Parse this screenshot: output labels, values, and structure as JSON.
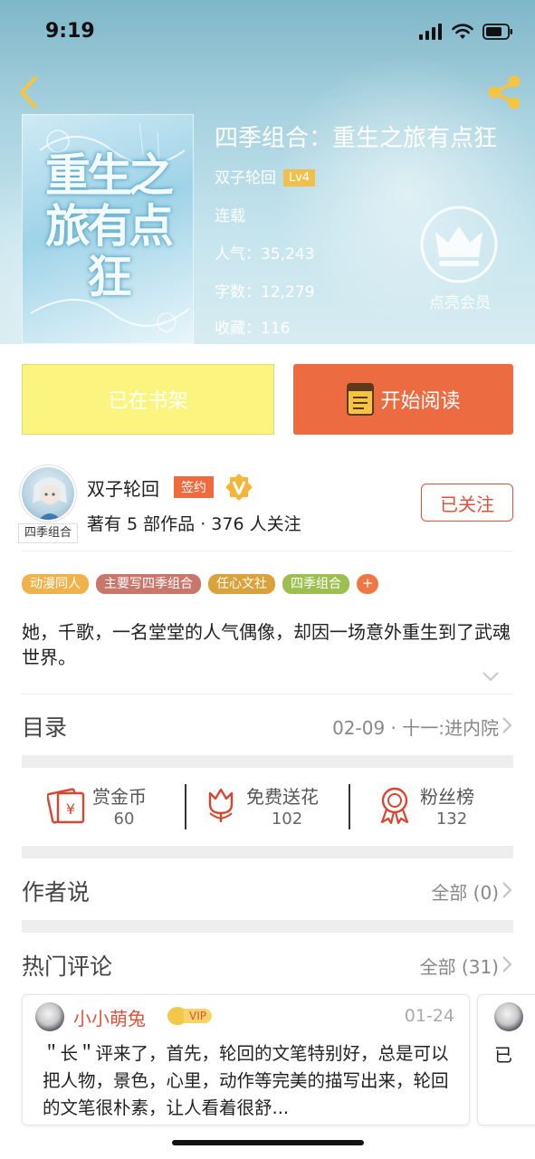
{
  "status_bar": {
    "time": "9:19"
  },
  "book": {
    "title": "四季组合：重生之旅有点狂",
    "author": "双子轮回",
    "author_level": "Lv4",
    "status": "连载",
    "popularity_label": "人气：",
    "popularity": "35,243",
    "words_label": "字数：",
    "words": "12,279",
    "favorites_label": "收藏：",
    "favorites": "116",
    "cover_title": "重生之旅有点狂"
  },
  "vip": {
    "label": "点亮会员"
  },
  "actions": {
    "shelf_label": "已在书架",
    "read_label": "开始阅读"
  },
  "author_section": {
    "name": "双子轮回",
    "sign_badge": "签约",
    "avatar_tag": "四季组合",
    "stats": "著有 5 部作品 · 376 人关注",
    "follow_label": "已关注"
  },
  "tags": [
    {
      "label": "动漫同人",
      "color": "#f0b24a"
    },
    {
      "label": "主要写四季组合",
      "color": "#c9776b"
    },
    {
      "label": "任心文社",
      "color": "#d9a23c"
    },
    {
      "label": "四季组合",
      "color": "#9cbf4f"
    }
  ],
  "tag_more": "+",
  "description": "她，千歌，一名堂堂的人气偶像，却因一场意外重生到了武魂世界。",
  "catalog": {
    "title": "目录",
    "latest": "02-09 · 十一:进内院"
  },
  "interactions": [
    {
      "label": "赏金币",
      "value": "60",
      "icon": "red-envelope-icon"
    },
    {
      "label": "免费送花",
      "value": "102",
      "icon": "flower-icon"
    },
    {
      "label": "粉丝榜",
      "value": "132",
      "icon": "medal-icon"
    }
  ],
  "author_says": {
    "title": "作者说",
    "all_label": "全部 (0)"
  },
  "hot_comments": {
    "title": "热门评论",
    "all_label": "全部 (31)"
  },
  "comments": [
    {
      "user": "小小萌兔",
      "vip": "VIP",
      "date": "01-24",
      "text": "＂长＂评来了，首先，轮回的文笔特别好，总是可以把人物，景色，心里，动作等完美的描写出来，轮回的文笔很朴素，让人看着很舒..."
    },
    {
      "text": "已"
    }
  ],
  "colors": {
    "accent": "#ec6b40",
    "shelf": "#fbf580",
    "follow": "#e0513b"
  }
}
